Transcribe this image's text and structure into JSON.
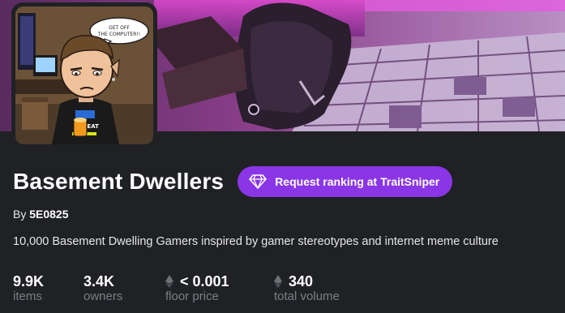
{
  "collection": {
    "name": "Basement Dwellers",
    "by_prefix": "By",
    "creator": "5E0825",
    "description": "10,000 Basement Dwelling Gamers inspired by gamer stereotypes and internet meme culture"
  },
  "actions": {
    "request_ranking_label": "Request ranking at TraitSniper",
    "request_ranking_icon": "diamond-icon"
  },
  "avatar": {
    "speech_bubble": "GET OFF THE COMPUTER!!",
    "shirt_text": "REPEAT"
  },
  "stats": [
    {
      "value": "9.9K",
      "label": "items",
      "icon": ""
    },
    {
      "value": "3.4K",
      "label": "owners",
      "icon": ""
    },
    {
      "value": "< 0.001",
      "label": "floor price",
      "icon": "eth-icon"
    },
    {
      "value": "340",
      "label": "total volume",
      "icon": "eth-icon"
    }
  ],
  "colors": {
    "background": "#1f2125",
    "accent": "#8a36e6",
    "muted_text": "#7b7f86"
  }
}
